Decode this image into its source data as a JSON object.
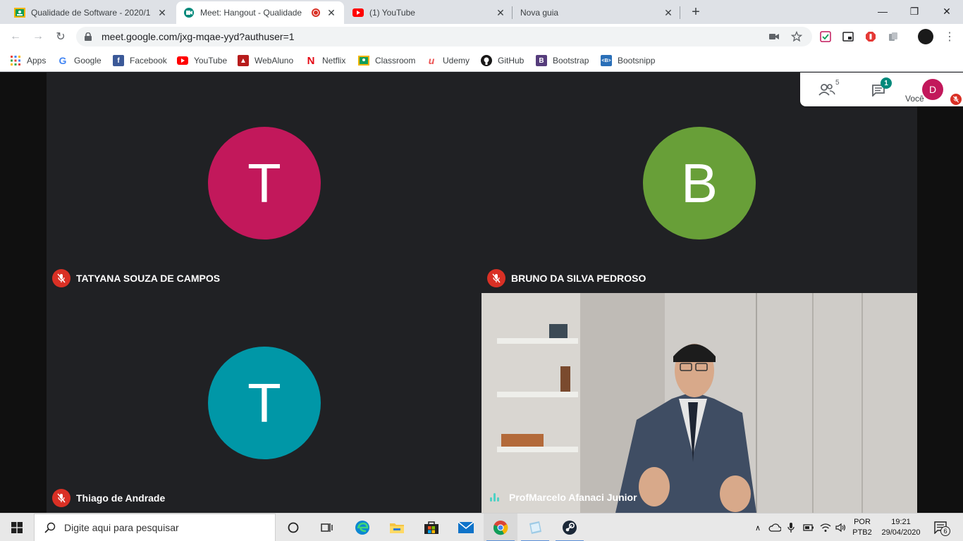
{
  "browser": {
    "tabs": [
      {
        "title": "Qualidade de Software - 2020/1",
        "icon": "classroom-icon",
        "active": false
      },
      {
        "title": "Meet: Hangout - Qualidade",
        "icon": "meet-icon",
        "active": true,
        "recording": true
      },
      {
        "title": "(1) YouTube",
        "icon": "youtube-icon",
        "active": false
      },
      {
        "title": "Nova guia",
        "icon": "",
        "active": false
      }
    ],
    "url": "meet.google.com/jxg-mqae-yyd?authuser=1",
    "bookmarks": [
      {
        "label": "Apps",
        "icon": "apps-grid-icon"
      },
      {
        "label": "Google",
        "icon": "google-icon"
      },
      {
        "label": "Facebook",
        "icon": "facebook-icon"
      },
      {
        "label": "YouTube",
        "icon": "youtube-icon"
      },
      {
        "label": "WebAluno",
        "icon": "webaluno-icon"
      },
      {
        "label": "Netflix",
        "icon": "netflix-icon"
      },
      {
        "label": "Classroom",
        "icon": "classroom-icon"
      },
      {
        "label": "Udemy",
        "icon": "udemy-icon"
      },
      {
        "label": "GitHub",
        "icon": "github-icon"
      },
      {
        "label": "Bootstrap",
        "icon": "bootstrap-icon"
      },
      {
        "label": "Bootsnipp",
        "icon": "bootsnipp-icon"
      }
    ]
  },
  "meet": {
    "participants_count": "5",
    "chat_badge": "1",
    "self_label": "Você",
    "self_initial": "D",
    "tiles": [
      {
        "initial": "T",
        "name": "TATYANA SOUZA DE CAMPOS",
        "color": "#c2185b",
        "muted": true
      },
      {
        "initial": "B",
        "name": "BRUNO DA SILVA PEDROSO",
        "color": "#689f38",
        "muted": true
      },
      {
        "initial": "T",
        "name": "Thiago de Andrade",
        "color": "#0097a7",
        "muted": true
      },
      {
        "initial": "",
        "name": "ProfMarcelo Afanaci Junior",
        "color": "",
        "muted": false,
        "video": true,
        "speaking": true
      }
    ]
  },
  "taskbar": {
    "search_placeholder": "Digite aqui para pesquisar",
    "language": "POR",
    "layout": "PTB2",
    "time": "19:21",
    "date": "29/04/2020",
    "notifications": "6"
  },
  "colors": {
    "meet_bg": "#202124",
    "mute_red": "#d93025",
    "self_avatar": "#c2185b"
  }
}
